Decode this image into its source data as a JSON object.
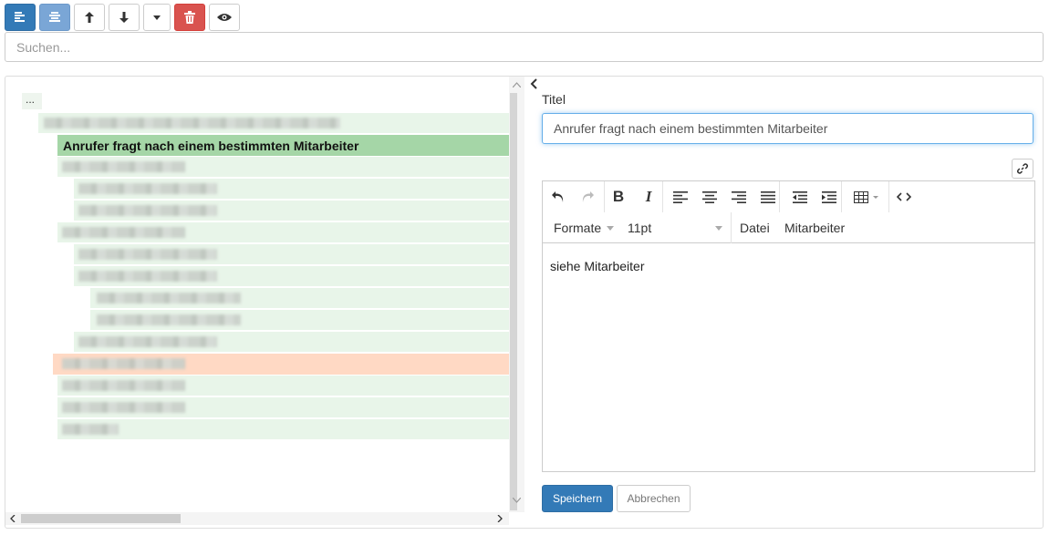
{
  "toolbar": {
    "buttons": [
      "align-left-icon",
      "align-center-icon",
      "arrow-up-icon",
      "arrow-down-icon",
      "caret-down-icon",
      "trash-icon",
      "eye-icon"
    ]
  },
  "search": {
    "placeholder": "Suchen..."
  },
  "tree": {
    "root_label": "...",
    "selected_item": "Anrufer fragt nach einem bestimmten Mitarbeiter"
  },
  "editor": {
    "title_label": "Titel",
    "title_value": "Anrufer fragt nach einem bestimmten Mitarbeiter",
    "menu": {
      "formats": "Formate",
      "font_size": "11pt",
      "file": "Datei",
      "employee": "Mitarbeiter"
    },
    "content": "siehe Mitarbeiter",
    "save_label": "Speichern",
    "cancel_label": "Abbrechen"
  },
  "colors": {
    "primary": "#337ab7",
    "danger": "#d9534f",
    "selected": "#a5d6a7",
    "highlight": "#ffd9c4",
    "tree_bg": "#e8f5e9"
  }
}
